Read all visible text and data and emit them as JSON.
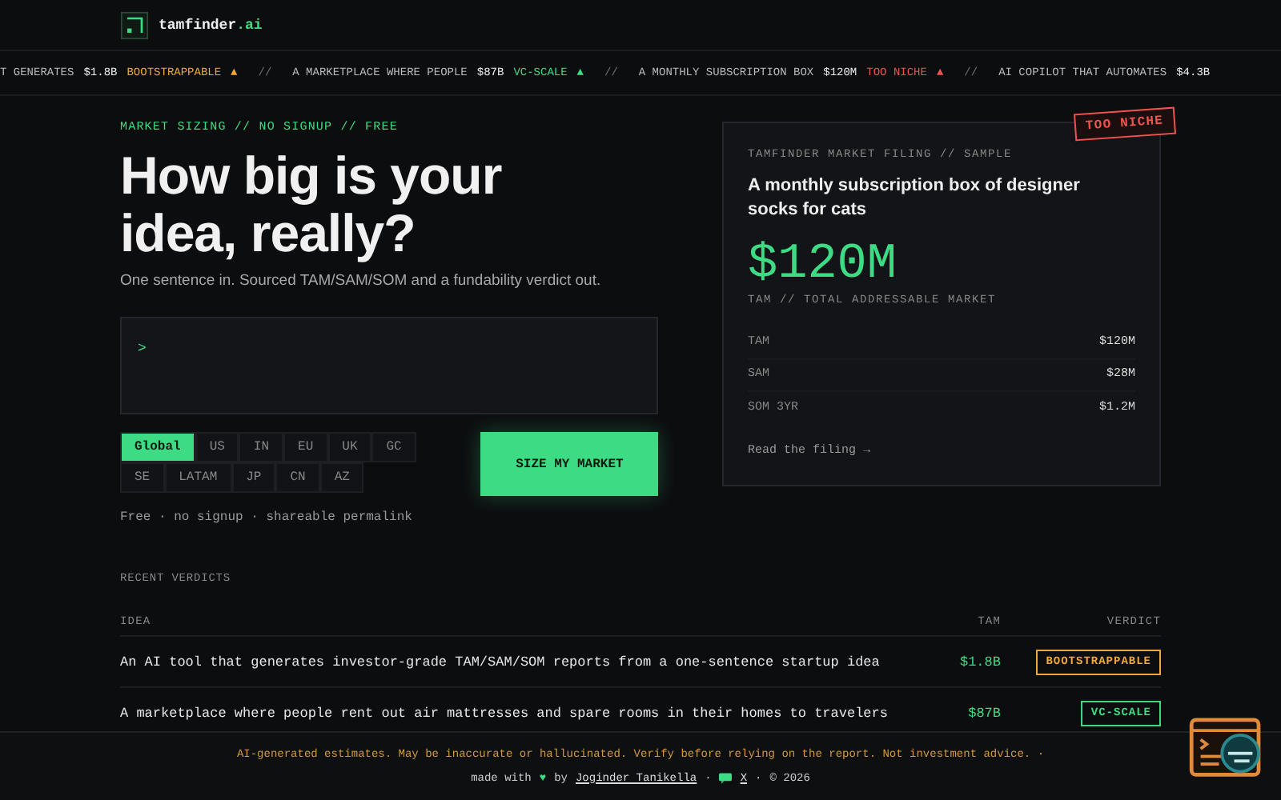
{
  "brand": {
    "name": "tamfinder",
    "tld": ".ai"
  },
  "ticker": {
    "separator": "//",
    "items": [
      {
        "text": "T GENERATES",
        "amount": "$1.8B",
        "verdict": "BOOTSTRAPPABLE",
        "arrow": "▲",
        "color": "#f0a83a"
      },
      {
        "text": "A MARKETPLACE WHERE PEOPLE",
        "amount": "$87B",
        "verdict": "VC-SCALE",
        "arrow": "▲",
        "color": "#3ddc84"
      },
      {
        "text": "A MONTHLY SUBSCRIPTION BOX",
        "amount": "$120M",
        "verdict": "TOO NICHE",
        "arrow": "▲",
        "color": "#ef5350"
      },
      {
        "text": "AI COPILOT THAT AUTOMATES",
        "amount": "$4.3B"
      }
    ]
  },
  "hero": {
    "eyebrow": "MARKET SIZING // NO SIGNUP // FREE",
    "title_lines": [
      "How big is your",
      "idea, really?"
    ],
    "subtitle": "One sentence in. Sourced TAM/SAM/SOM and a fundability verdict out.",
    "prompt": ">",
    "regions": [
      {
        "label": "Global",
        "selected": true
      },
      {
        "label": "US",
        "selected": false
      },
      {
        "label": "IN",
        "selected": false
      },
      {
        "label": "EU",
        "selected": false
      },
      {
        "label": "UK",
        "selected": false
      },
      {
        "label": "GC",
        "selected": false
      },
      {
        "label": "SE",
        "selected": false
      },
      {
        "label": "LATAM",
        "selected": false
      },
      {
        "label": "JP",
        "selected": false
      },
      {
        "label": "CN",
        "selected": false
      },
      {
        "label": "AZ",
        "selected": false
      }
    ],
    "button": "SIZE MY MARKET",
    "note": "Free · no signup · shareable permalink"
  },
  "sample": {
    "stamp": "TOO NICHE",
    "color": "#ef5350",
    "eyebrow": "TAMFINDER MARKET FILING // SAMPLE",
    "idea": "A monthly subscription box of designer socks for cats",
    "tam": "$120M",
    "tam_label": "TAM // TOTAL ADDRESSABLE MARKET",
    "rows": [
      {
        "label": "TAM",
        "value": "$120M"
      },
      {
        "label": "SAM",
        "value": "$28M"
      },
      {
        "label": "SOM 3YR",
        "value": "$1.2M"
      }
    ],
    "link": "Read the filing →"
  },
  "recent": {
    "title": "RECENT VERDICTS",
    "columns": [
      "IDEA",
      "TAM",
      "VERDICT"
    ],
    "rows": [
      {
        "idea": "An AI tool that generates investor-grade TAM/SAM/SOM reports from a one-sentence startup idea",
        "tam": "$1.8B",
        "verdict": "BOOTSTRAPPABLE",
        "color": "#f0a83a"
      },
      {
        "idea": "A marketplace where people rent out air mattresses and spare rooms in their homes to travelers",
        "tam": "$87B",
        "verdict": "VC-SCALE",
        "color": "#3ddc84"
      }
    ]
  },
  "footer": {
    "disclaimer": "AI-generated estimates. May be inaccurate or hallucinated. Verify before relying on the report. Not investment advice. ·",
    "made_with": "made with",
    "heart": "♥",
    "by": "by",
    "author": "Joginder Tanikella",
    "dot1": "·",
    "x_link": "X",
    "dot2": "·",
    "copyright": "© 2026"
  }
}
